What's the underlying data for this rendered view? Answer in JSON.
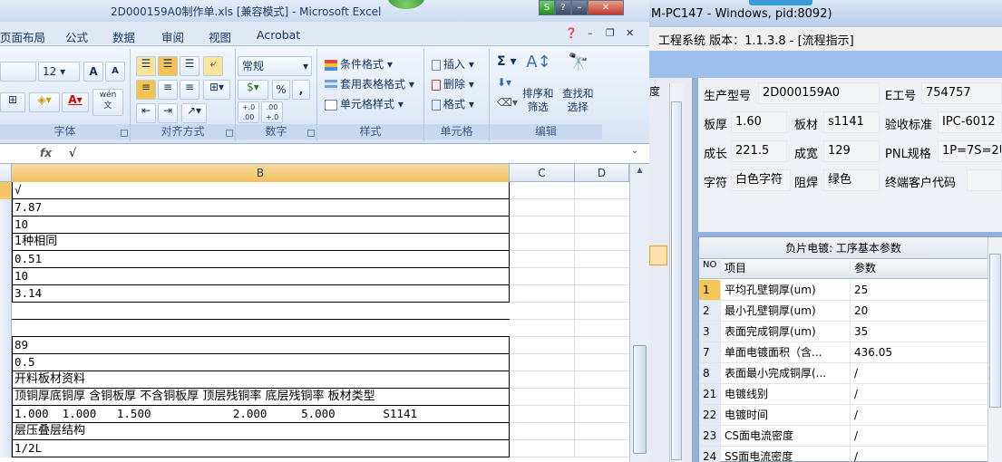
{
  "excel": {
    "title": "2D000159A0制作单.xls  [兼容模式] - Microsoft Excel",
    "tabs": [
      "页面布局",
      "公式",
      "数据",
      "审阅",
      "视图",
      "Acrobat"
    ],
    "ribbon": {
      "font_size": "12",
      "grow_font": "A",
      "shrink_font": "A",
      "wen": "wén\n文",
      "number_format": "常规",
      "percent": "%",
      "comma": ",",
      "dec_inc": "+.0\n.00",
      "dec_dec": ".00\n+.0",
      "conditional_format": "条件格式",
      "table_format": "套用表格格式",
      "cell_style": "单元格样式",
      "insert": "插入",
      "delete": "删除",
      "format": "格式",
      "sigma": "Σ",
      "sort_filter": "排序和\n筛选",
      "find_select": "查找和\n选择",
      "groups": [
        "字体",
        "对齐方式",
        "数字",
        "样式",
        "单元格",
        "编辑"
      ]
    },
    "formula": {
      "fx": "fx",
      "value": "√"
    },
    "columns": [
      "B",
      "C",
      "D"
    ],
    "rows": [
      {
        "b": "√",
        "sel": true
      },
      {
        "b": "7.87"
      },
      {
        "b": "10"
      },
      {
        "b": "1种相同",
        "han": true
      },
      {
        "b": "0.51"
      },
      {
        "b": "10"
      },
      {
        "b": "3.14"
      },
      {
        "b": "",
        "blank": true
      },
      {
        "b": "",
        "blank": true
      },
      {
        "b": "89"
      },
      {
        "b": "0.5"
      },
      {
        "b": "开料板材资料",
        "han": true
      },
      {
        "b": "顶铜厚底铜厚 含铜板厚 不含铜板厚 顶层残铜率 底层残铜率 板材类型",
        "han": true
      },
      {
        "b": "1.000  1.000   1.500            2.000     5.000       S1141"
      },
      {
        "b": "层压叠层结构",
        "han": true
      },
      {
        "b": "1/2L"
      }
    ]
  },
  "app": {
    "title": "M-PC147 - Windows, pid:8092)",
    "menu": "工程系统  版本：1.1.3.8 - [流程指示]",
    "left_label": "度",
    "fields": {
      "model_label": "生产型号",
      "model": "2D000159A0",
      "e_label": "E工号",
      "e": "754757",
      "thick_label": "板厚",
      "thick": "1.60",
      "mat_label": "板材",
      "mat": "s1141",
      "std_label": "验收标准",
      "std": "IPC-6012",
      "len_label": "成长",
      "len": "221.5",
      "wid_label": "成宽",
      "wid": "129",
      "pnl_label": "PNL规格",
      "pnl": "1P=7S=2U",
      "char_label": "字符",
      "char": "白色字符",
      "mask_label": "阻焊",
      "mask": "绿色",
      "cust_label": "终端客户代码",
      "cust": ""
    },
    "params": {
      "title": "负片电镀: 工序基本参数",
      "headers": [
        "NO",
        "项目",
        "参数"
      ],
      "rows": [
        {
          "no": "1",
          "item": "平均孔壁铜厚(um)",
          "val": "25",
          "active": true
        },
        {
          "no": "2",
          "item": "最小孔壁铜厚(um)",
          "val": "20"
        },
        {
          "no": "3",
          "item": "表面完成铜厚(um)",
          "val": "35"
        },
        {
          "no": "7",
          "item": "单面电镀面积（含...",
          "val": "436.05"
        },
        {
          "no": "8",
          "item": "表面最小完成铜厚(...",
          "val": "/"
        },
        {
          "no": "21",
          "item": "电镀线别",
          "val": "/"
        },
        {
          "no": "22",
          "item": "电镀时间",
          "val": "/"
        },
        {
          "no": "23",
          "item": "CS面电流密度",
          "val": "/"
        },
        {
          "no": "24",
          "item": "SS面电流密度",
          "val": "/"
        }
      ]
    }
  }
}
